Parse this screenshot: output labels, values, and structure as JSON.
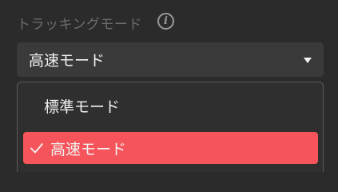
{
  "setting": {
    "label": "トラッキングモード",
    "info_icon": "info-icon",
    "selected_value": "高速モード"
  },
  "dropdown": {
    "options": [
      {
        "label": "標準モード",
        "selected": false
      },
      {
        "label": "高速モード",
        "selected": true
      }
    ]
  },
  "colors": {
    "background": "#2b2b2b",
    "selected_option": "#f5555a",
    "label_text": "#6c6c6c"
  }
}
